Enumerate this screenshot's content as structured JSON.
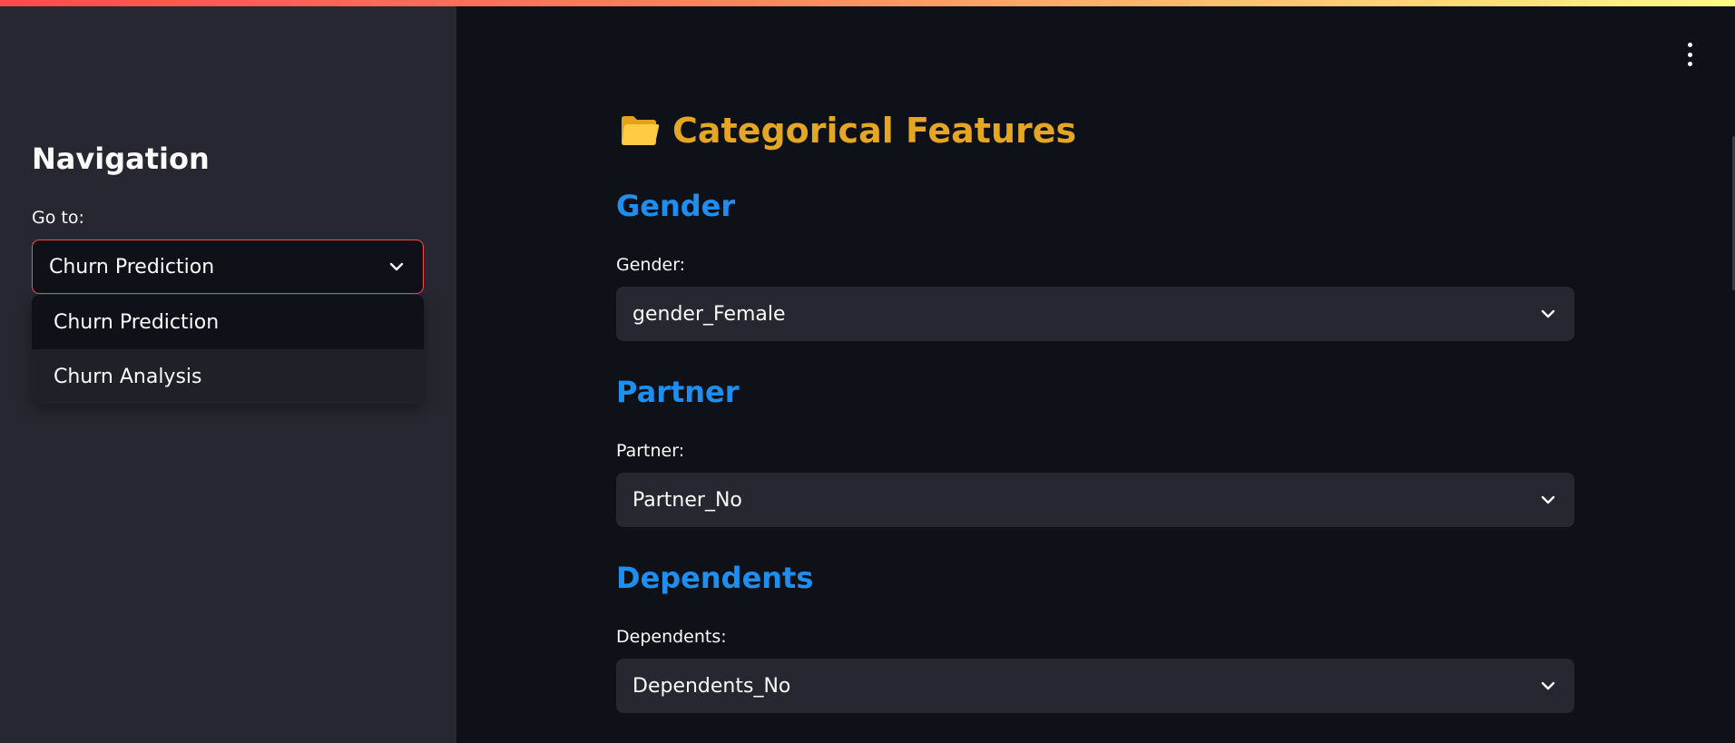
{
  "sidebar": {
    "title": "Navigation",
    "goto_label": "Go to:",
    "selected": "Churn Prediction",
    "options": [
      "Churn Prediction",
      "Churn Analysis"
    ]
  },
  "main": {
    "title": "Categorical Features",
    "title_icon": "folder-icon",
    "sections": [
      {
        "heading": "Gender",
        "label": "Gender:",
        "value": "gender_Female"
      },
      {
        "heading": "Partner",
        "label": "Partner:",
        "value": "Partner_No"
      },
      {
        "heading": "Dependents",
        "label": "Dependents:",
        "value": "Dependents_No"
      }
    ]
  },
  "colors": {
    "accent": "#ff4b4b",
    "title": "#e5a623",
    "section_heading": "#1f8ef1",
    "sidebar_bg": "#262730",
    "main_bg": "#0e1117"
  }
}
